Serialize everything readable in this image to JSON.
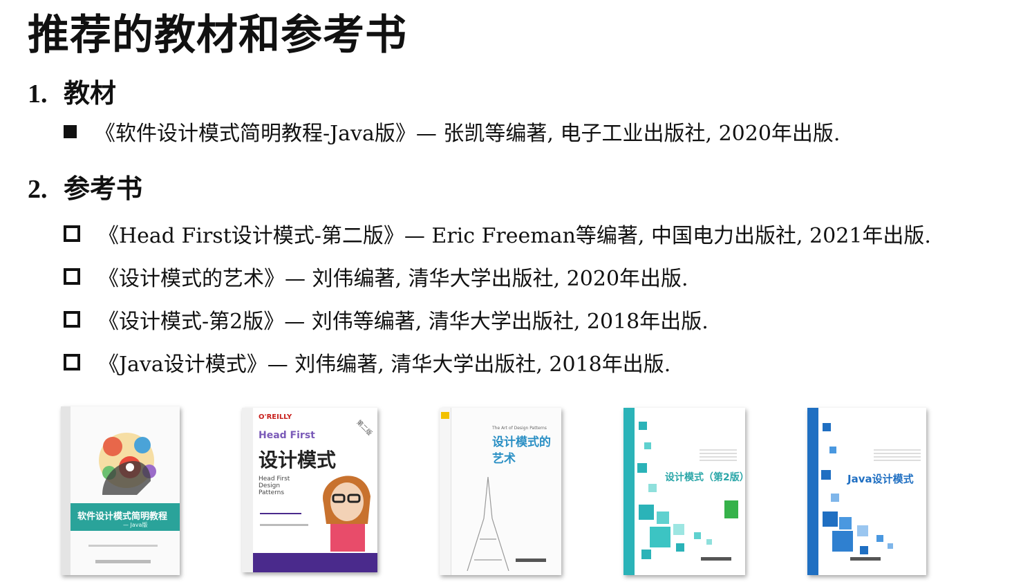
{
  "page": {
    "title": "推荐的教材和参考书"
  },
  "sections": [
    {
      "number": "1.",
      "heading": "教材",
      "items": [
        {
          "text": "《软件设计模式简明教程-Java版》— 张凯等编著, 电子工业出版社, 2020年出版."
        }
      ]
    },
    {
      "number": "2.",
      "heading": "参考书",
      "items": [
        {
          "text": "《Head First设计模式-第二版》— Eric Freeman等编著, 中国电力出版社, 2021年出版."
        },
        {
          "text": "《设计模式的艺术》— 刘伟编著, 清华大学出版社, 2020年出版."
        },
        {
          "text": "《设计模式-第2版》— 刘伟等编著, 清华大学出版社, 2018年出版."
        },
        {
          "text": "《Java设计模式》— 刘伟编著, 清华大学出版社, 2018年出版."
        }
      ]
    }
  ],
  "book_covers": [
    {
      "title": "软件设计模式简明教程",
      "subtitle": "— Java版",
      "accent": "#2aa39a"
    },
    {
      "brand": "O'REILLY",
      "series": "Head First",
      "title": "设计模式",
      "subtitle": "Head First Design Patterns",
      "edition": "第二版",
      "accent": "#4a2a8c"
    },
    {
      "title": "设计模式的艺术",
      "subtitle": "The Art of Design Patterns",
      "accent": "#2a8fc4"
    },
    {
      "title": "设计模式（第2版）",
      "accent": "#2bb3b8"
    },
    {
      "title": "Java设计模式",
      "accent": "#1f6fc2"
    }
  ]
}
